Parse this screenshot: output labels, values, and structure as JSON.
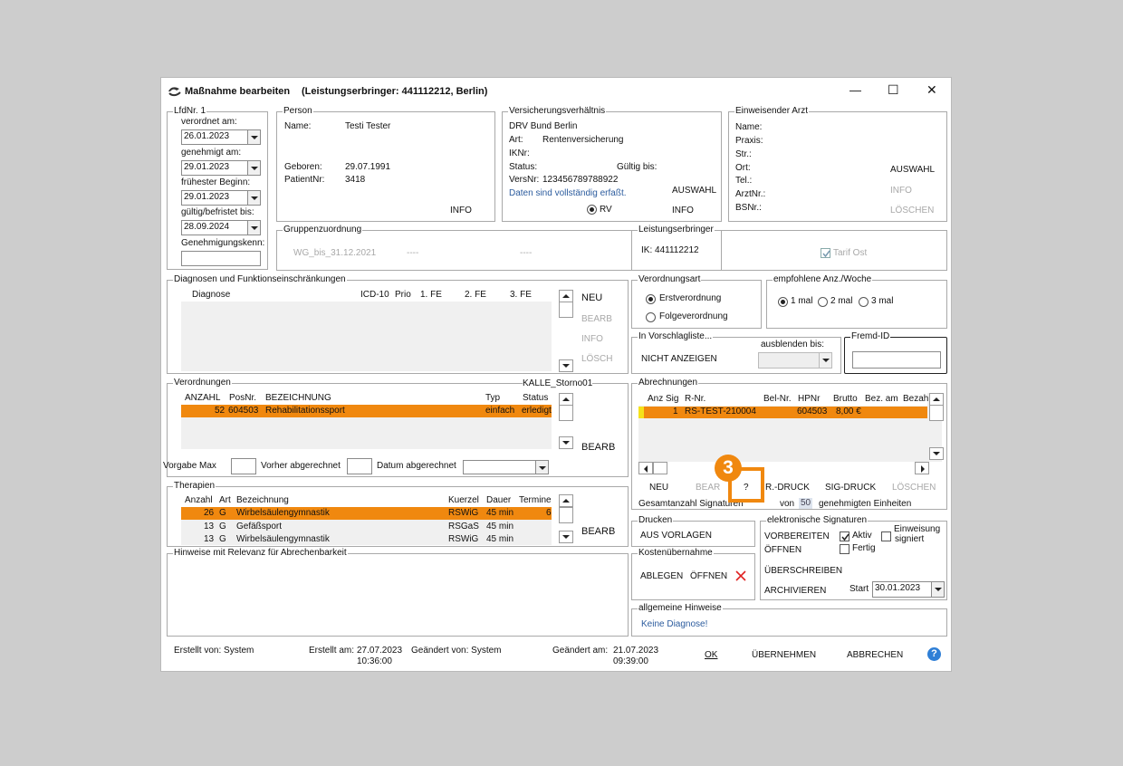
{
  "window": {
    "title": "Maßnahme bearbeiten",
    "subtitle": "(Leistungserbringer: 441112212,  Berlin)",
    "minimize": "—",
    "maximize": "☐",
    "close": "✕"
  },
  "lfd": {
    "legend": "LfdNr. 1",
    "verordnet_label": "verordnet am:",
    "verordnet": "26.01.2023",
    "genehmigt_label": "genehmigt am:",
    "genehmigt": "29.01.2023",
    "fruehester_label": "frühester Beginn:",
    "fruehester": "29.01.2023",
    "gueltig_label": "gültig/befristet bis:",
    "gueltig": "28.09.2024",
    "genehmigungskenn_label": "Genehmigungskenn:"
  },
  "person": {
    "legend": "Person",
    "name_label": "Name:",
    "name": "Testi Tester",
    "geboren_label": "Geboren:",
    "geboren": "29.07.1991",
    "patientnr_label": "PatientNr:",
    "patientnr": "3418",
    "info": "INFO"
  },
  "versicherung": {
    "legend": "Versicherungsverhältnis",
    "kasse": "DRV Bund Berlin",
    "art_label": "Art:",
    "art": "Rentenversicherung",
    "iknr_label": "IKNr:",
    "status_label": "Status:",
    "gueltig_label": "Gültig bis:",
    "versnr_label": "VersNr:",
    "versnr": "123456789788922",
    "vollstaendig": "Daten sind vollständig erfaßt.",
    "auswahl": "AUSWAHL",
    "rv": "RV",
    "info": "INFO"
  },
  "arzt": {
    "legend": "Einweisender Arzt",
    "name_label": "Name:",
    "praxis_label": "Praxis:",
    "str_label": "Str.:",
    "ort_label": "Ort:",
    "tel_label": "Tel.:",
    "arztnr_label": "ArztNr.:",
    "bsnr_label": "BSNr.:",
    "auswahl": "AUSWAHL",
    "info": "INFO",
    "loeschen": "LÖSCHEN"
  },
  "gruppe": {
    "legend": "Gruppenzuordnung",
    "value": "WG_bis_31.12.2021",
    "dash1": "----",
    "dash2": "----"
  },
  "leistungserbringer": {
    "legend": "Leistungserbringer",
    "ik": "IK: 441112212",
    "tarif": "Tarif Ost"
  },
  "diagnosen": {
    "legend": "Diagnosen und Funktionseinschränkungen",
    "headers": [
      "Diagnose",
      "ICD-10",
      "Prio",
      "1. FE",
      "2. FE",
      "3. FE"
    ],
    "neu": "NEU",
    "bearb": "BEARB",
    "info": "INFO",
    "loesch": "LÖSCH"
  },
  "verordnungsart": {
    "legend": "Verordnungsart",
    "erst": "Erstverordnung",
    "folge": "Folgeverordnung"
  },
  "anzahl": {
    "legend": "empfohlene Anz./Woche",
    "opt1": "1 mal",
    "opt2": "2 mal",
    "opt3": "3 mal"
  },
  "vorschlag": {
    "legend": "In Vorschlagliste...",
    "nicht": "NICHT ANZEIGEN",
    "ausblenden": "ausblenden bis:"
  },
  "fremd": {
    "legend": "Fremd-ID"
  },
  "verordnungen": {
    "legend": "Verordnungen",
    "kalle": "KALLE_Storno01",
    "headers": [
      "ANZAHL",
      "PosNr.",
      "BEZEICHNUNG",
      "Typ",
      "Status"
    ],
    "rows": [
      {
        "anzahl": "52",
        "posnr": "604503",
        "bez": "Rehabilitationssport",
        "typ": "einfach",
        "status": "erledigt"
      }
    ],
    "bearb": "BEARB",
    "vorgabe": "Vorgabe Max",
    "vorher": "Vorher abgerechnet",
    "datum": "Datum abgerechnet"
  },
  "abrechnungen": {
    "legend": "Abrechnungen",
    "headers": [
      "Anz",
      "Sig",
      "R-Nr.",
      "Bel-Nr.",
      "HPNr",
      "Brutto",
      "Bez. am",
      "Bezahl"
    ],
    "rows": [
      {
        "anz": "1",
        "rnr": "RS-TEST-210004",
        "hpnr": "604503",
        "brutto": "8,00 €"
      }
    ],
    "neu": "NEU",
    "bearb": "BEAR",
    "q": "?",
    "rdruck": "R.-DRUCK",
    "sigdruck": "SIG-DRUCK",
    "loeschen": "LÖSCHEN",
    "gesamt": "Gesamtanzahl Signaturen",
    "von": "von",
    "einheiten": "50",
    "genehmigt": "genehmigten Einheiten"
  },
  "callout": {
    "number": "3",
    "color": "#f0880f"
  },
  "therapien": {
    "legend": "Therapien",
    "headers": [
      "Anzahl",
      "Art",
      "Bezeichnung",
      "Kuerzel",
      "Dauer",
      "Termine"
    ],
    "rows": [
      {
        "anzahl": "26",
        "art": "G",
        "bez": "Wirbelsäulengymnastik",
        "kuerzel": "RSWiG",
        "dauer": "45 min",
        "termine": "6"
      },
      {
        "anzahl": "13",
        "art": "G",
        "bez": "Gefäßsport",
        "kuerzel": "RSGaS",
        "dauer": "45 min",
        "termine": ""
      },
      {
        "anzahl": "13",
        "art": "G",
        "bez": "Wirbelsäulengymnastik",
        "kuerzel": "RSWiG",
        "dauer": "45 min",
        "termine": ""
      }
    ],
    "bearb": "BEARB"
  },
  "hinweise": {
    "legend": "Hinweise mit Relevanz für Abrechenbarkeit"
  },
  "drucken": {
    "legend": "Drucken",
    "vorlagen": "AUS VORLAGEN"
  },
  "kosten": {
    "legend": "Kostenübernahme",
    "ablegen": "ABLEGEN",
    "oeffnen": "ÖFFNEN"
  },
  "esig": {
    "legend": "elektronische Signaturen",
    "vorbereiten": "VORBEREITEN",
    "aktiv": "Aktiv",
    "einweisung1": "Einweisung",
    "einweisung2": "signiert",
    "oeffnen": "ÖFFNEN",
    "fertig": "Fertig",
    "ueberschreiben": "ÜBERSCHREIBEN",
    "archivieren": "ARCHIVIEREN",
    "start_label": "Start",
    "start": "30.01.2023"
  },
  "allg": {
    "legend": "allgemeine Hinweise",
    "text": "Keine Diagnose!"
  },
  "footer": {
    "erstellt_von": "Erstellt von: System",
    "erstellt_am_label": "Erstellt am:",
    "erstellt_am": "27.07.2023",
    "erstellt_zeit": "10:36:00",
    "geaendert_von": "Geändert von: System",
    "geaendert_am_label": "Geändert am:",
    "geaendert_am": "21.07.2023",
    "geaendert_zeit": "09:39:00",
    "ok": "OK",
    "uebernehmen": "ÜBERNEHMEN",
    "abbrechen": "ABBRECHEN",
    "help": "?"
  }
}
